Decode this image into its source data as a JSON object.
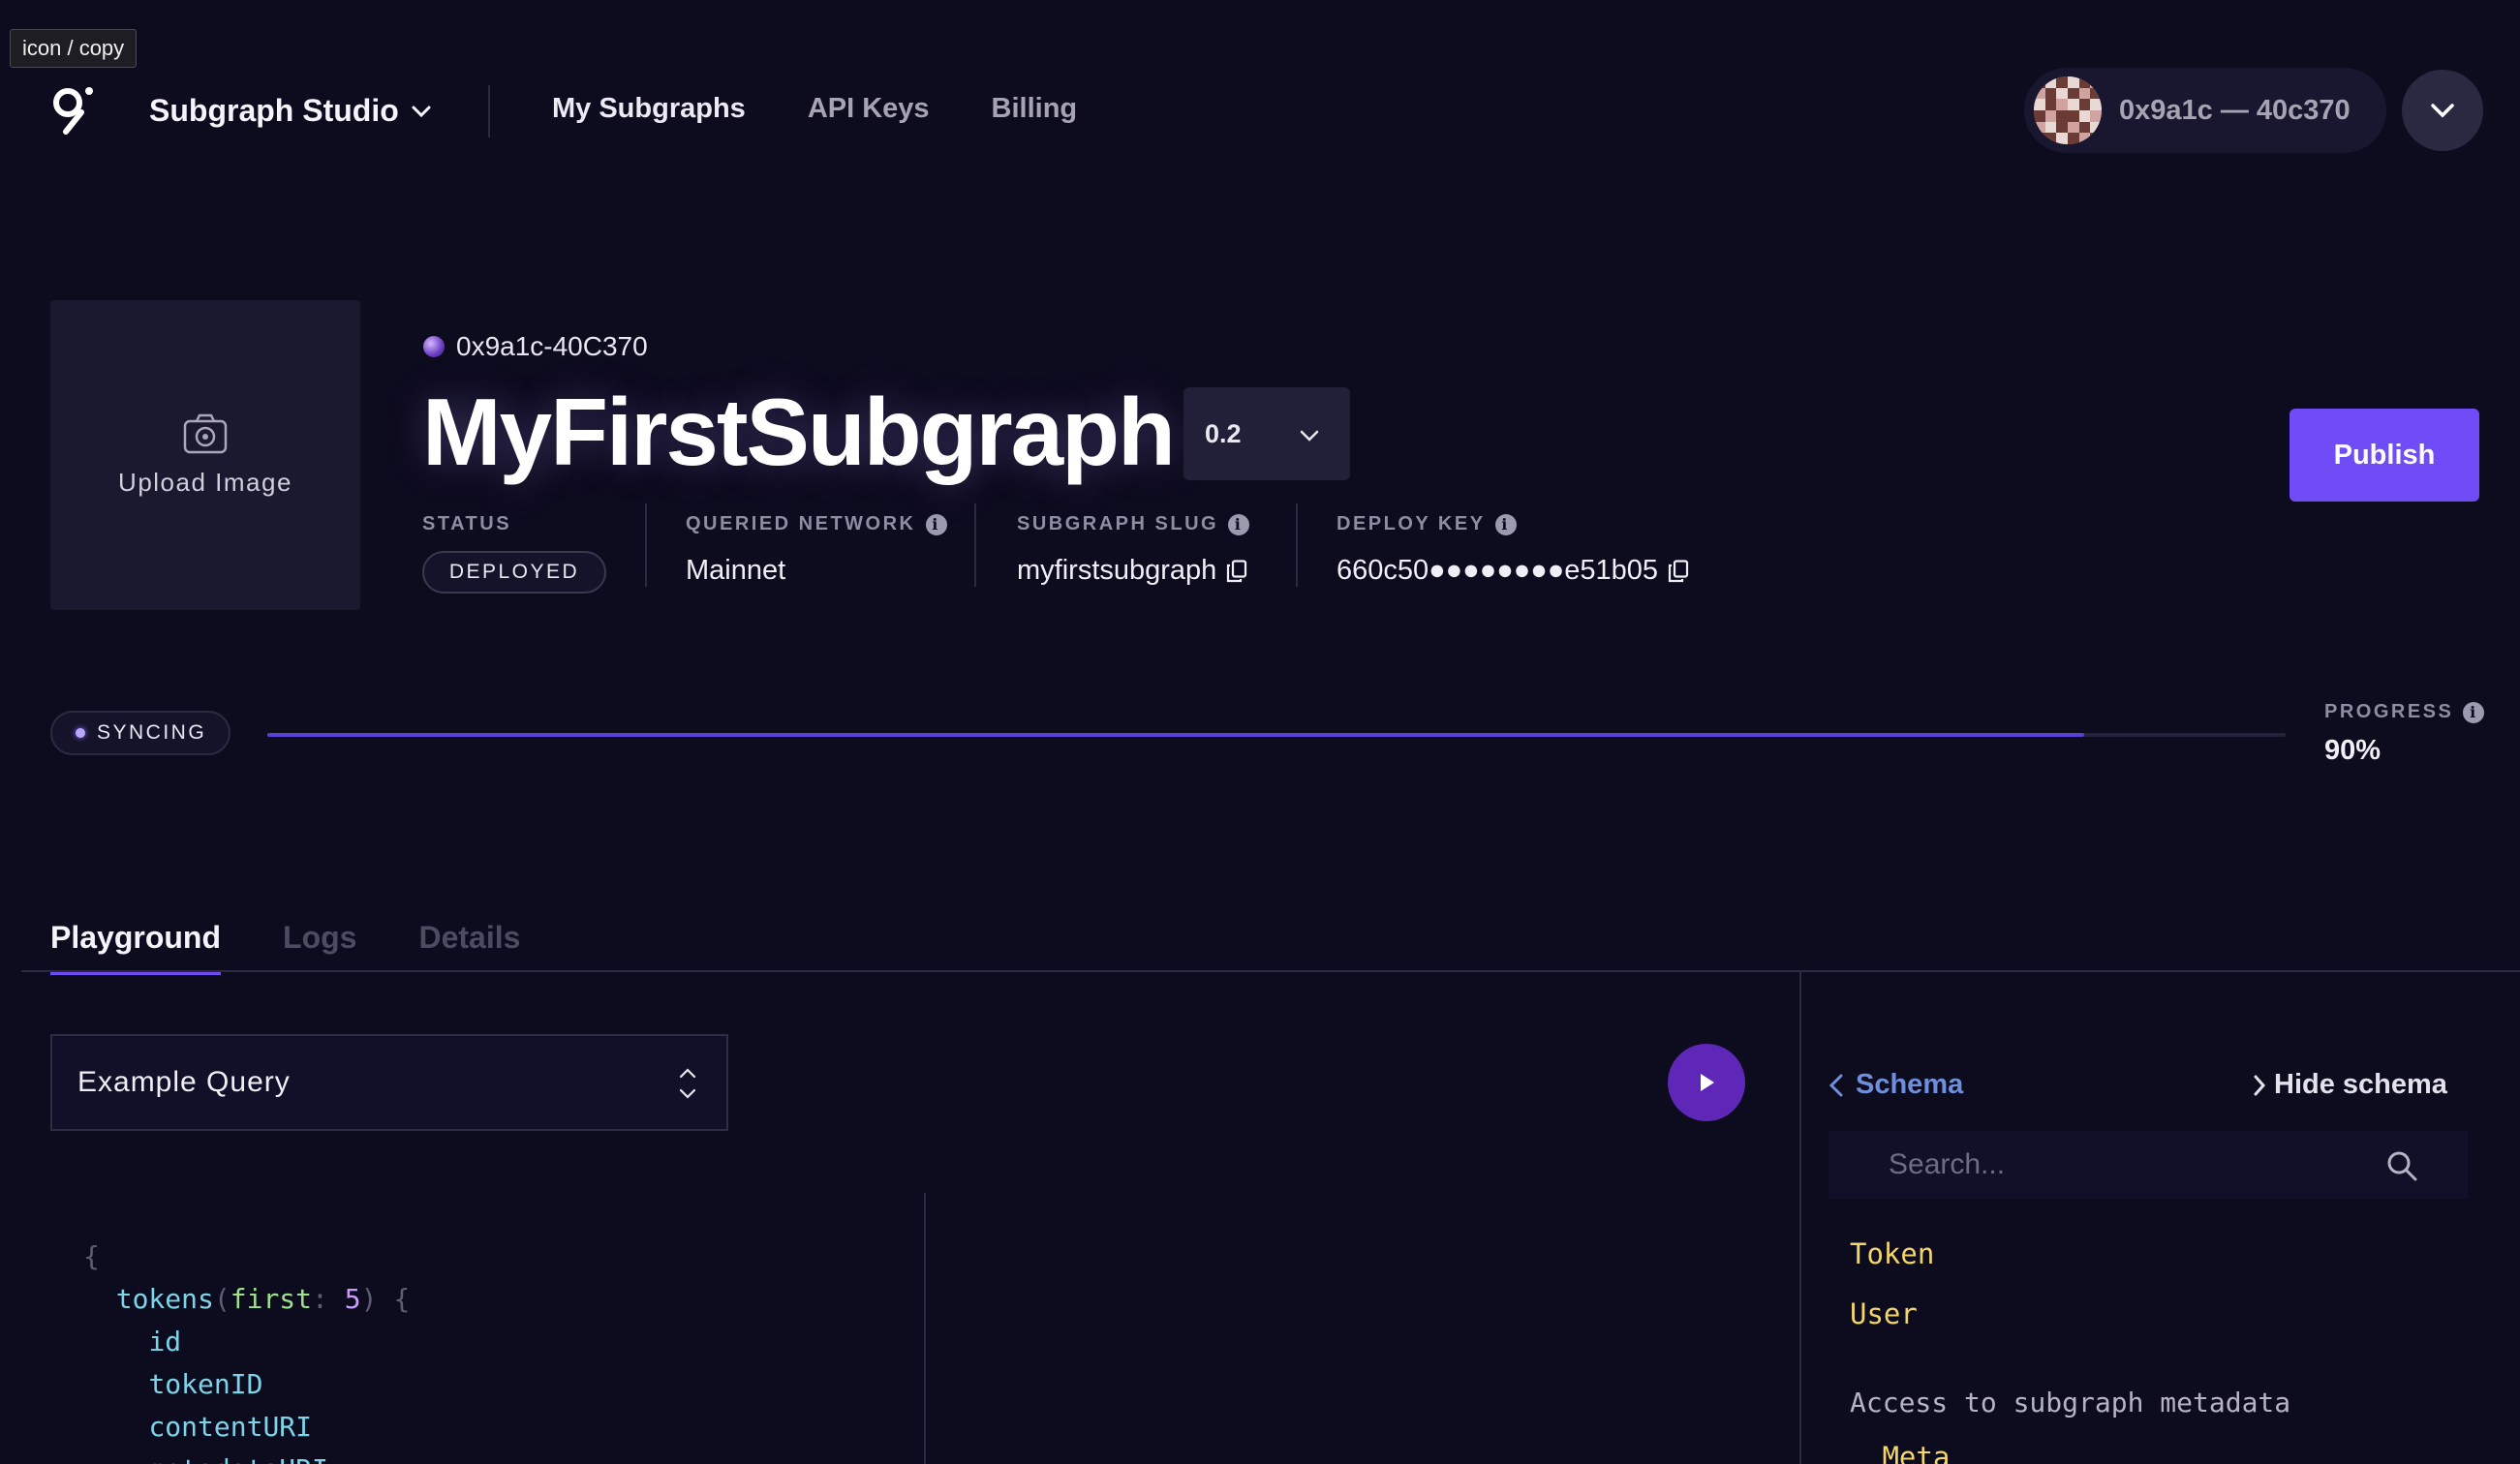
{
  "tooltip": "icon / copy",
  "header": {
    "studio_label": "Subgraph Studio",
    "nav": [
      {
        "label": "My Subgraphs"
      },
      {
        "label": "API Keys"
      },
      {
        "label": "Billing"
      }
    ],
    "account_label": "0x9a1c — 40c370"
  },
  "subgraph": {
    "upload_label": "Upload Image",
    "owner": "0x9a1c-40C370",
    "title": "MyFirstSubgraph",
    "version": "0.2",
    "status_label": "STATUS",
    "status_value": "DEPLOYED",
    "network_label": "QUERIED NETWORK",
    "network_value": "Mainnet",
    "slug_label": "SUBGRAPH SLUG",
    "slug_value": "myfirstsubgraph",
    "deploy_key_label": "DEPLOY KEY",
    "deploy_key_value": "660c50●●●●●●●●e51b05",
    "publish_label": "Publish"
  },
  "sync": {
    "status": "SYNCING",
    "progress_label": "PROGRESS",
    "progress_text": "90%",
    "progress_fraction": 0.9
  },
  "tabs": [
    {
      "label": "Playground",
      "active": true
    },
    {
      "label": "Logs",
      "active": false
    },
    {
      "label": "Details",
      "active": false
    }
  ],
  "playground": {
    "query_name": "Example Query",
    "code": {
      "open_brace": "{",
      "root_field": "tokens",
      "arg_name": "first",
      "arg_value": "5",
      "fields": [
        "id",
        "tokenID",
        "contentURI",
        "metadataURI"
      ]
    }
  },
  "schema": {
    "back_label": "Schema",
    "hide_label": "Hide schema",
    "search_placeholder": "Search...",
    "types": [
      "Token",
      "User"
    ],
    "meta_description": "Access to subgraph metadata",
    "meta_field": "_Meta"
  },
  "colors": {
    "background": "#0d0b1e",
    "accent": "#6f4cf6",
    "progress_fill": "#5940d6",
    "schema_type": "#f2d66a"
  }
}
